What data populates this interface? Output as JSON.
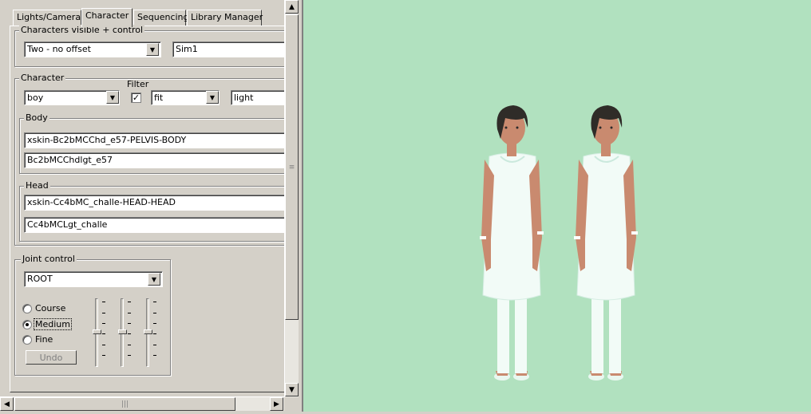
{
  "tabs": [
    {
      "label": "Lights/Camera"
    },
    {
      "label": "Character",
      "active": true
    },
    {
      "label": "Sequencing"
    },
    {
      "label": "Library Manager"
    }
  ],
  "characters_visible": {
    "legend": "Characters visible + control",
    "mode_select": "Two - no offset",
    "sim_name": "Sim1"
  },
  "character": {
    "legend": "Character",
    "filter_label": "Filter",
    "gender_select": "boy",
    "filter_checked": true,
    "fitness_select": "fit",
    "skin_tone": "light",
    "body": {
      "legend": "Body",
      "mesh": "xskin-Bc2bMCChd_e57-PELVIS-BODY",
      "texture": "Bc2bMCChdlgt_e57"
    },
    "head": {
      "legend": "Head",
      "mesh": "xskin-Cc4bMC_challe-HEAD-HEAD",
      "texture": "Cc4bMCLgt_challe"
    }
  },
  "joint_control": {
    "legend": "Joint control",
    "joint_select": "ROOT",
    "radios": [
      {
        "label": "Course",
        "checked": false
      },
      {
        "label": "Medium",
        "checked": true
      },
      {
        "label": "Fine",
        "checked": false
      }
    ],
    "undo_label": "Undo"
  },
  "icons": {
    "dropdown": "chevron-down-icon",
    "check": "checkmark-icon",
    "scroll_up": "arrow-up-icon",
    "scroll_down": "arrow-down-icon",
    "scroll_left": "arrow-left-icon",
    "scroll_right": "arrow-right-icon"
  },
  "colors": {
    "viewport_bg": "#b1e1bf",
    "panel_bg": "#d4d0c8",
    "outfit": "#f2fbf7",
    "skin": "#c98a6f",
    "hair": "#2f2c28"
  }
}
